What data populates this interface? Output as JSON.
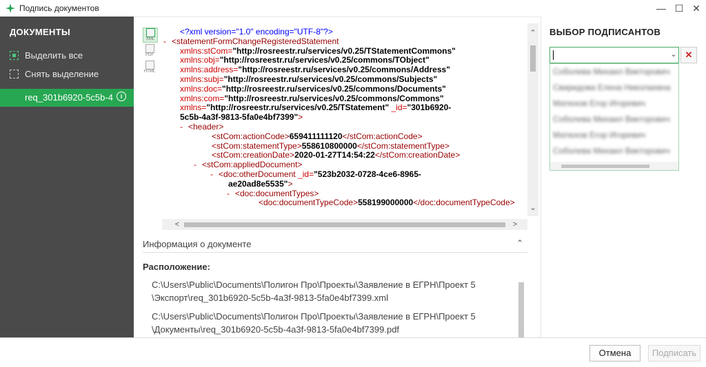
{
  "window": {
    "title": "Подпись документов",
    "minimize": "—",
    "maximize": "☐",
    "close": "✕"
  },
  "sidebar": {
    "title": "ДОКУМЕНТЫ",
    "select_all": "Выделить все",
    "deselect": "Снять выделение",
    "document": "req_301b6920-5c5b-4",
    "info_icon": "i"
  },
  "formats": {
    "xml": "XML",
    "pdf": "PDF",
    "html": "HTML"
  },
  "xml_view": {
    "lines": [
      {
        "indent": 26,
        "dash": "",
        "parts": [
          [
            "pi",
            "<?xml version=\"1.0\" encoding=\"UTF-8\"?>"
          ]
        ]
      },
      {
        "indent": 14,
        "dash": "-",
        "parts": [
          [
            "tag",
            "<statementFormChangeRegisteredStatement"
          ]
        ]
      },
      {
        "indent": 26,
        "dash": "",
        "parts": [
          [
            "attr",
            "xmlns:stCom="
          ],
          [
            "val",
            "\"http://rosreestr.ru/services/v0.25/TStatementCommons\""
          ]
        ]
      },
      {
        "indent": 26,
        "dash": "",
        "parts": [
          [
            "attr",
            "xmlns:obj="
          ],
          [
            "val",
            "\"http://rosreestr.ru/services/v0.25/commons/TObject\""
          ]
        ]
      },
      {
        "indent": 26,
        "dash": "",
        "parts": [
          [
            "attr",
            "xmlns:address="
          ],
          [
            "val",
            "\"http://rosreestr.ru/services/v0.25/commons/Address\""
          ]
        ]
      },
      {
        "indent": 26,
        "dash": "",
        "parts": [
          [
            "attr",
            "xmlns:subj="
          ],
          [
            "val",
            "\"http://rosreestr.ru/services/v0.25/commons/Subjects\""
          ]
        ]
      },
      {
        "indent": 26,
        "dash": "",
        "parts": [
          [
            "attr",
            "xmlns:doc="
          ],
          [
            "val",
            "\"http://rosreestr.ru/services/v0.25/commons/Documents\""
          ]
        ]
      },
      {
        "indent": 26,
        "dash": "",
        "parts": [
          [
            "attr",
            "xmlns:com="
          ],
          [
            "val",
            "\"http://rosreestr.ru/services/v0.25/commons/Commons\""
          ]
        ]
      },
      {
        "indent": 26,
        "dash": "",
        "parts": [
          [
            "attr",
            "xmlns="
          ],
          [
            "val",
            "\"http://rosreestr.ru/services/v0.25/TStatement\""
          ],
          [
            "attr",
            " _id="
          ],
          [
            "val",
            "\"301b6920-"
          ]
        ]
      },
      {
        "indent": 26,
        "dash": "",
        "parts": [
          [
            "val",
            "5c5b-4a3f-9813-5fa0e4bf7399\""
          ],
          [
            "tag",
            ">"
          ]
        ]
      },
      {
        "indent": 38,
        "dash": "-",
        "parts": [
          [
            "tag",
            "<header>"
          ]
        ]
      },
      {
        "indent": 72,
        "dash": "",
        "parts": [
          [
            "tag",
            "<stCom:actionCode>"
          ],
          [
            "val",
            "659411111120"
          ],
          [
            "tag",
            "</stCom:actionCode>"
          ]
        ]
      },
      {
        "indent": 72,
        "dash": "",
        "parts": [
          [
            "tag",
            "<stCom:statementType>"
          ],
          [
            "val",
            "558610800000"
          ],
          [
            "tag",
            "</stCom:statementType>"
          ]
        ]
      },
      {
        "indent": 72,
        "dash": "",
        "parts": [
          [
            "tag",
            "<stCom:creationDate>"
          ],
          [
            "val",
            "2020-01-27T14:54:22"
          ],
          [
            "tag",
            "</stCom:creationDate>"
          ]
        ]
      },
      {
        "indent": 58,
        "dash": "-",
        "parts": [
          [
            "tag",
            "<stCom:appliedDocument>"
          ]
        ]
      },
      {
        "indent": 82,
        "dash": "-",
        "parts": [
          [
            "tag",
            "<doc:otherDocument"
          ],
          [
            "attr",
            " _id="
          ],
          [
            "val",
            "\"523b2032-0728-4ce6-8965-"
          ]
        ]
      },
      {
        "indent": 96,
        "dash": "",
        "parts": [
          [
            "val",
            "ae20ad8e5535\""
          ],
          [
            "tag",
            ">"
          ]
        ]
      },
      {
        "indent": 106,
        "dash": "-",
        "parts": [
          [
            "tag",
            "<doc:documentTypes>"
          ]
        ]
      },
      {
        "indent": 140,
        "dash": "",
        "parts": [
          [
            "tag",
            "<doc:documentTypeCode>"
          ],
          [
            "val",
            "558199000000"
          ],
          [
            "tag",
            "</doc:documentTypeCode>"
          ]
        ]
      }
    ]
  },
  "info_panel": {
    "title": "Информация о документе",
    "location_label": "Расположение:",
    "paths": [
      [
        "C:\\Users\\Public\\Documents\\Полигон Про\\Проекты\\Заявление в ЕГРН\\Проект 5",
        "\\Экспорт\\req_301b6920-5c5b-4a3f-9813-5fa0e4bf7399.xml"
      ],
      [
        "C:\\Users\\Public\\Documents\\Полигон Про\\Проекты\\Заявление в ЕГРН\\Проект 5",
        "\\Документы\\req_301b6920-5c5b-4a3f-9813-5fa0e4bf7399.pdf"
      ]
    ]
  },
  "signers": {
    "title": "ВЫБОР ПОДПИСАНТОВ",
    "input_value": "",
    "clear": "✕",
    "options": [
      "Соболева Михаил Викторович",
      "Свиридова Елена Николаевна",
      "Матюхов Егор Игоревич",
      "Соболева Михаил Викторович",
      "Матюхов Егор Игоревич",
      "Соболева Михаил Викторович"
    ]
  },
  "footer": {
    "cancel": "Отмена",
    "sign": "Подписать"
  },
  "colors": {
    "accent": "#27a752",
    "sidebar_bg": "#4a4a4a"
  }
}
